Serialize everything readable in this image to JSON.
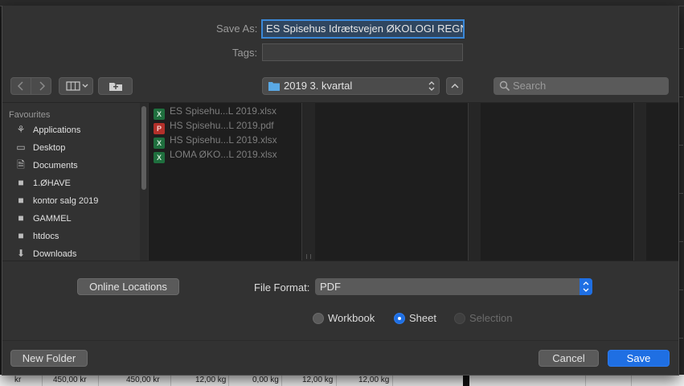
{
  "dialog": {
    "save_as_label": "Save As:",
    "save_as_value": "ES Spisehus Idrætsvejen ØKOLOGI REGN",
    "tags_label": "Tags:",
    "tags_value": ""
  },
  "toolbar": {
    "back_icon": "chevron-left-icon",
    "forward_icon": "chevron-right-icon",
    "view_icon": "column-view-icon",
    "new_folder_icon": "new-folder-icon",
    "location_value": "2019 3. kvartal",
    "expand_icon": "chevron-up-icon",
    "search_placeholder": "Search"
  },
  "sidebar": {
    "header": "Favourites",
    "items": [
      {
        "label": "Applications",
        "icon": "applications-icon"
      },
      {
        "label": "Desktop",
        "icon": "desktop-icon"
      },
      {
        "label": "Documents",
        "icon": "documents-icon"
      },
      {
        "label": "1.ØHAVE",
        "icon": "folder-icon"
      },
      {
        "label": "kontor salg 2019",
        "icon": "folder-icon"
      },
      {
        "label": "GAMMEL",
        "icon": "folder-icon"
      },
      {
        "label": "htdocs",
        "icon": "folder-icon"
      },
      {
        "label": "Downloads",
        "icon": "downloads-icon"
      }
    ]
  },
  "files": [
    {
      "name": "ES Spisehu...L 2019.xlsx",
      "type": "xlsx"
    },
    {
      "name": "HS Spisehu...L 2019.pdf",
      "type": "pdf"
    },
    {
      "name": "HS Spisehu...L 2019.xlsx",
      "type": "xlsx"
    },
    {
      "name": "LOMA ØKO...L 2019.xlsx",
      "type": "xlsx"
    }
  ],
  "options": {
    "online_locations_label": "Online Locations",
    "file_format_label": "File Format:",
    "file_format_value": "PDF",
    "radios": [
      {
        "label": "Workbook",
        "selected": false,
        "enabled": true
      },
      {
        "label": "Sheet",
        "selected": true,
        "enabled": true
      },
      {
        "label": "Selection",
        "selected": false,
        "enabled": false
      }
    ]
  },
  "footer": {
    "new_folder_label": "New Folder",
    "cancel_label": "Cancel",
    "save_label": "Save"
  },
  "background_sheet": {
    "cells": [
      "kr",
      "450,00 kr",
      "450,00 kr",
      "12,00 kg",
      "0,00 kg",
      "12,00 kg",
      "12,00 kg"
    ]
  },
  "colors": {
    "accent": "#1f6fe3",
    "dialog_bg": "#323232"
  }
}
